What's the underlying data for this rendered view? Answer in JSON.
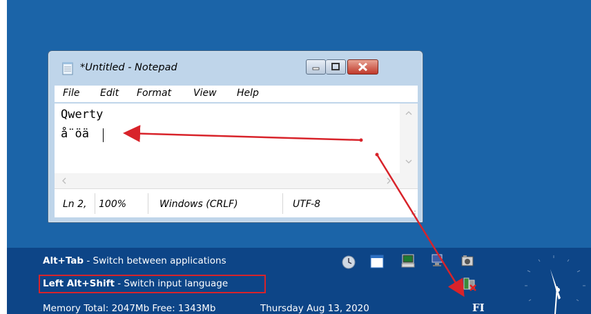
{
  "window": {
    "title": "*Untitled - Notepad",
    "menu": [
      "File",
      "Edit",
      "Format",
      "View",
      "Help"
    ],
    "editor_lines": [
      "Qwerty",
      "å¨öä"
    ],
    "status": {
      "position": "Ln 2,",
      "zoom": "100%",
      "line_endings": "Windows (CRLF)",
      "encoding": "UTF-8"
    }
  },
  "taskbar": {
    "hint1_key": "Alt+Tab",
    "hint1_text": " - Switch between applications",
    "hint2_key": "Left Alt+Shift",
    "hint2_text": " - Switch input language",
    "memory": "Memory Total: 2047Mb Free: 1343Mb",
    "date": "Thursday  Aug 13, 2020",
    "input_language": "FI"
  },
  "colors": {
    "desktop": "#1b64a8",
    "taskbar": "#0d4587",
    "annotation": "#d8232a"
  },
  "icons": [
    "notepad-icon",
    "minimize-icon",
    "maximize-icon",
    "close-icon",
    "clock-icon",
    "window-icon",
    "computer-icon",
    "network-icon",
    "camera-icon",
    "network-disconnected-icon",
    "analog-clock-icon"
  ]
}
